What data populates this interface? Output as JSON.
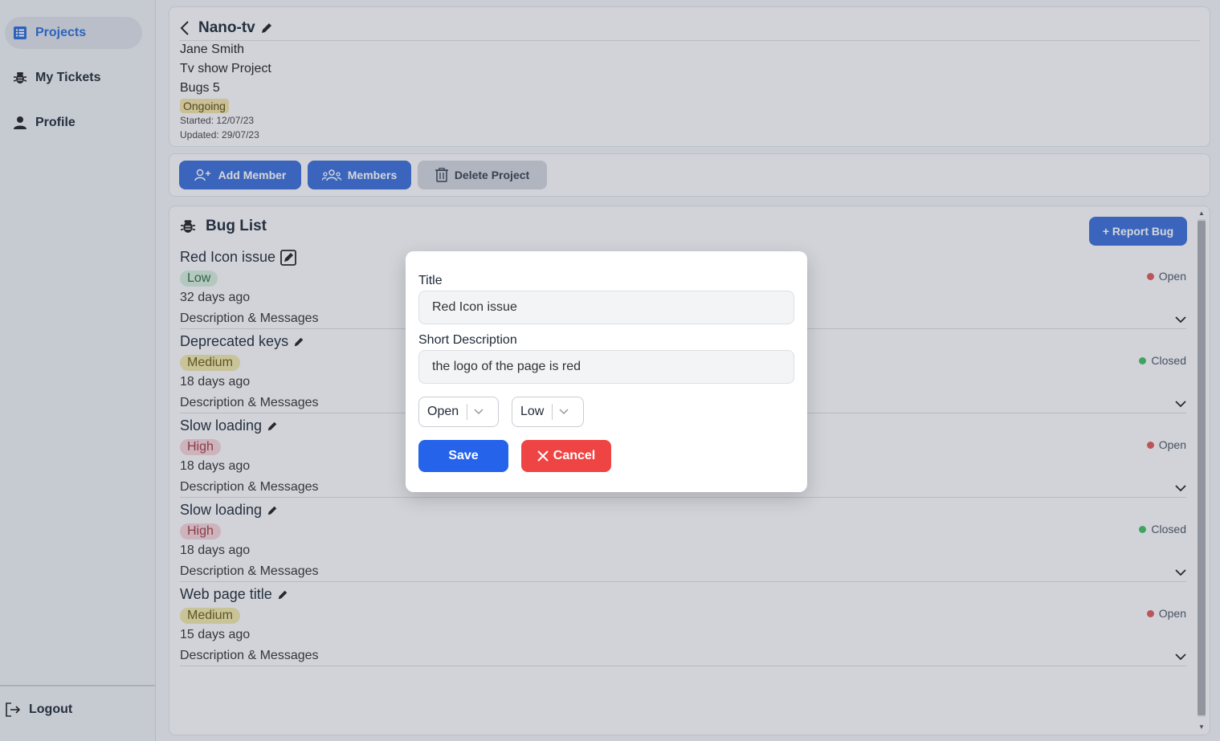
{
  "sidebar": {
    "items": [
      {
        "label": "Projects",
        "icon": "list-icon",
        "active": true
      },
      {
        "label": "My Tickets",
        "icon": "bug-icon"
      },
      {
        "label": "Profile",
        "icon": "user-icon"
      }
    ],
    "logout_label": "Logout"
  },
  "project": {
    "title": "Nano-tv",
    "owner": "Jane Smith",
    "type": "Tv show Project",
    "bugs": "Bugs 5",
    "status": "Ongoing",
    "started": "Started: 12/07/23",
    "updated": "Updated: 29/07/23"
  },
  "actions": {
    "add_member": "Add Member",
    "members": "Members",
    "delete_project": "Delete Project"
  },
  "buglist": {
    "title": "Bug List",
    "report_label": "+ Report Bug",
    "desc_label": "Description & Messages",
    "bugs": [
      {
        "title": "Red Icon issue",
        "priority": "Low",
        "ago": "32 days ago",
        "status": "Open"
      },
      {
        "title": "Deprecated keys",
        "priority": "Medium",
        "ago": "18 days ago",
        "status": "Closed"
      },
      {
        "title": "Slow loading",
        "priority": "High",
        "ago": "18 days ago",
        "status": "Open"
      },
      {
        "title": "Slow loading",
        "priority": "High",
        "ago": "18 days ago",
        "status": "Closed"
      },
      {
        "title": "Web page title",
        "priority": "Medium",
        "ago": "15 days ago",
        "status": "Open"
      }
    ]
  },
  "modal": {
    "title_label": "Title",
    "title_value": "Red Icon issue",
    "desc_label": "Short Description",
    "desc_value": "the logo of the page is red",
    "status_value": "Open",
    "priority_value": "Low",
    "save_label": "Save",
    "cancel_label": "Cancel"
  },
  "colors": {
    "accent": "#3b6fd8",
    "open": "#e05a5a",
    "closed": "#3fbf62",
    "cancel": "#ef4444"
  }
}
